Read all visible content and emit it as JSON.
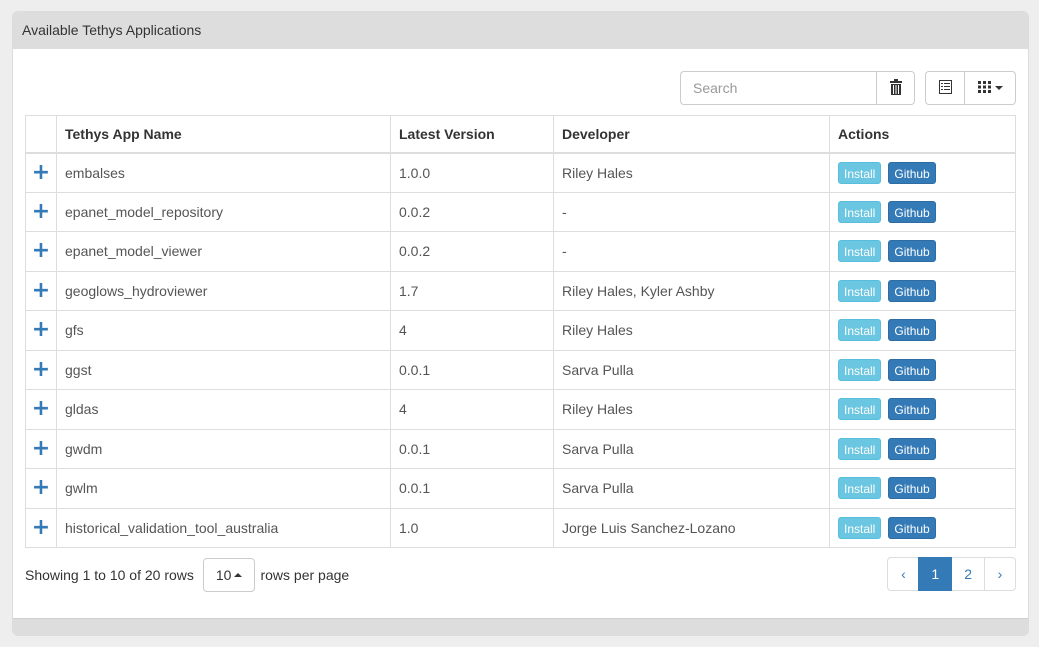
{
  "panel": {
    "title": "Available Tethys Applications"
  },
  "toolbar": {
    "search_placeholder": "Search",
    "search_value": "",
    "clear_icon": "trash-icon",
    "toggle_view_icon": "list-view-icon",
    "columns_icon": "grid-columns-icon"
  },
  "table": {
    "headers": [
      "",
      "Tethys App Name",
      "Latest Version",
      "Developer",
      "Actions"
    ],
    "rows": [
      {
        "name": "embalses",
        "version": "1.0.0",
        "developer": "Riley Hales"
      },
      {
        "name": "epanet_model_repository",
        "version": "0.0.2",
        "developer": "-"
      },
      {
        "name": "epanet_model_viewer",
        "version": "0.0.2",
        "developer": "-"
      },
      {
        "name": "geoglows_hydroviewer",
        "version": "1.7",
        "developer": "Riley Hales, Kyler Ashby"
      },
      {
        "name": "gfs",
        "version": "4",
        "developer": "Riley Hales"
      },
      {
        "name": "ggst",
        "version": "0.0.1",
        "developer": "Sarva Pulla"
      },
      {
        "name": "gldas",
        "version": "4",
        "developer": "Riley Hales"
      },
      {
        "name": "gwdm",
        "version": "0.0.1",
        "developer": "Sarva Pulla"
      },
      {
        "name": "gwlm",
        "version": "0.0.1",
        "developer": "Sarva Pulla"
      },
      {
        "name": "historical_validation_tool_australia",
        "version": "1.0",
        "developer": "Jorge Luis Sanchez-Lozano"
      }
    ],
    "expand_symbol": "+",
    "install_label": "Install",
    "github_label": "Github"
  },
  "pagination": {
    "showing_text": "Showing 1 to 10 of 20 rows",
    "page_size": "10",
    "rows_per_page_text": "rows per page",
    "prev": "‹",
    "pages": [
      "1",
      "2"
    ],
    "active_page": "1",
    "next": "›"
  },
  "colors": {
    "primary": "#337ab7",
    "info": "#5bc0de",
    "heading_bg": "#dddddd"
  }
}
